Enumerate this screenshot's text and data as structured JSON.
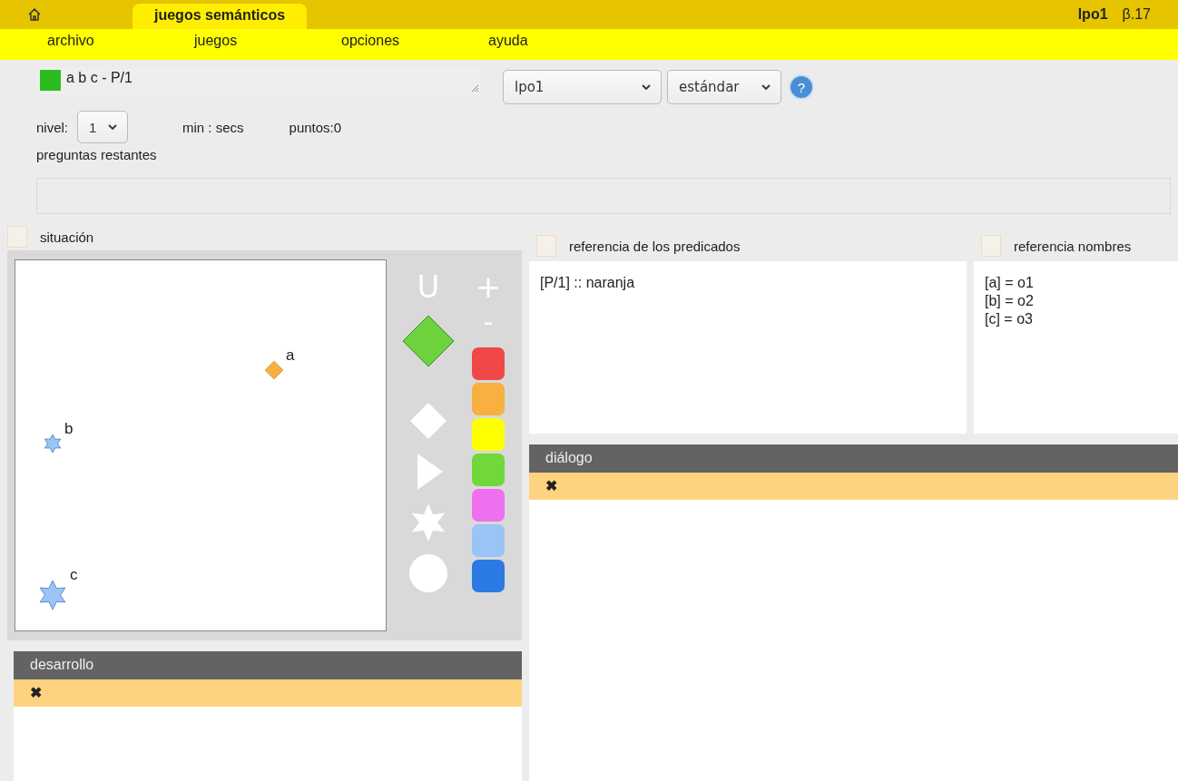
{
  "header": {
    "tab": {
      "label": "juegos semánticos",
      "selected": true
    },
    "language": "lpo1",
    "version": "β.17"
  },
  "menu": [
    "archivo",
    "juegos",
    "opciones",
    "ayuda"
  ],
  "formula": {
    "value": "a b c - P/1"
  },
  "selects": [
    {
      "value": "lpo1"
    },
    {
      "value": "estándar"
    }
  ],
  "help": "?",
  "level": {
    "label": "nivel:",
    "value": "1"
  },
  "timer": "min : secs",
  "points": "puntos:0",
  "remaining": "preguntas restantes",
  "situation": {
    "label": "situación",
    "checked": false,
    "objects": [
      {
        "name": "a",
        "kind": "diamond",
        "large": false,
        "color": "#f6b042"
      },
      {
        "name": "b",
        "kind": "star",
        "large": false,
        "color": "#99c4f5"
      },
      {
        "name": "c",
        "kind": "star",
        "large": true,
        "color": "#99c4f5"
      }
    ],
    "tools": [
      "U",
      "+",
      "-"
    ],
    "preview": {
      "kind": "diamond",
      "color": "#6fd23f"
    },
    "shapes": [
      {
        "kind": "diamond"
      },
      {
        "kind": "triangle"
      },
      {
        "kind": "star"
      },
      {
        "kind": "circle"
      }
    ],
    "colors": [
      {
        "color": "#f04848"
      },
      {
        "color": "#f8b040"
      },
      {
        "color": "#ffff00"
      },
      {
        "color": "#70d83a"
      },
      {
        "color": "#ee70ee"
      },
      {
        "color": "#99c4f5"
      },
      {
        "color": "#2a7ae2"
      }
    ]
  },
  "development": {
    "title": "desarrollo",
    "rows": [
      "✖"
    ]
  },
  "predicates": {
    "label": "referencia de los predicados",
    "checked": false,
    "lines": [
      "[P/1] :: naranja"
    ]
  },
  "names": {
    "label": "referencia nombres",
    "checked": false,
    "lines": [
      "[a] = o1",
      "[b] = o2",
      "[c] = o3"
    ]
  },
  "dialog": {
    "title": "diálogo",
    "rows": [
      "✖"
    ]
  }
}
